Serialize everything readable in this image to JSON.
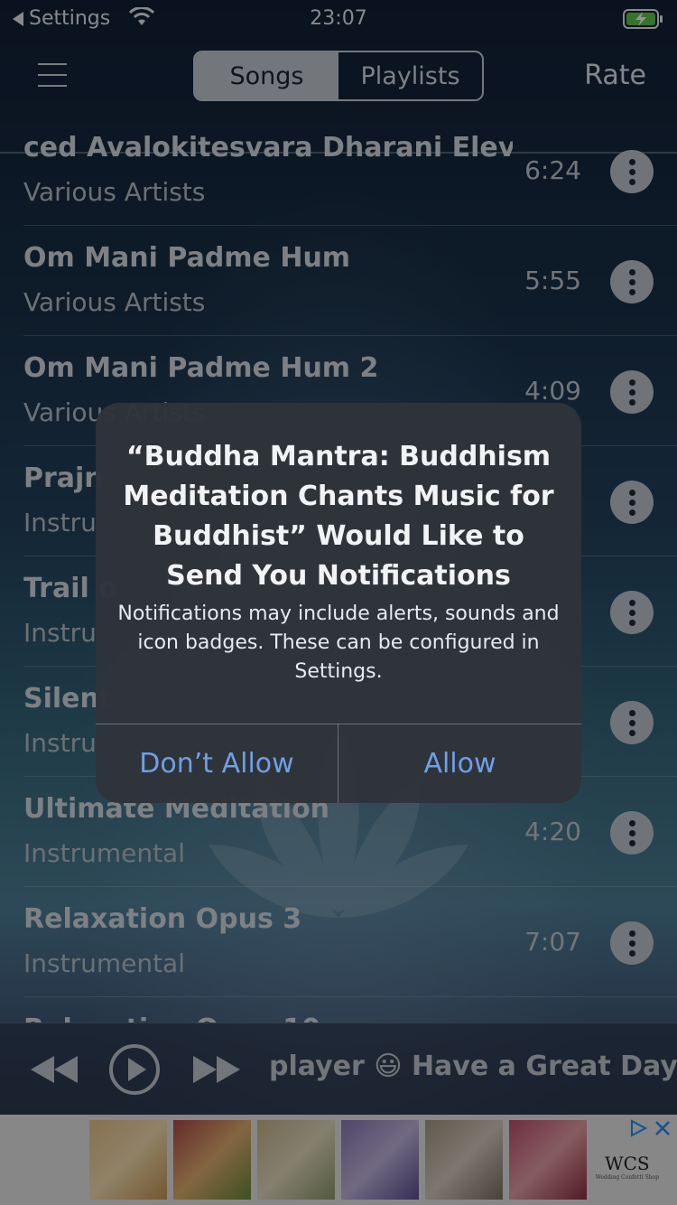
{
  "status_bar": {
    "back_label": "Settings",
    "time": "23:07"
  },
  "nav": {
    "tabs": [
      "Songs",
      "Playlists"
    ],
    "active_tab": "Songs",
    "rate_label": "Rate"
  },
  "songs": [
    {
      "title": "ced Avalokitesvara Dharani        Elev",
      "artist": "Various Artists",
      "duration": "6:24"
    },
    {
      "title": "Om Mani Padme Hum",
      "artist": "Various Artists",
      "duration": "5:55"
    },
    {
      "title": "Om Mani Padme Hum 2",
      "artist": "Various Artists",
      "duration": "4:09"
    },
    {
      "title": "Prajn",
      "artist": "Instru",
      "duration": ""
    },
    {
      "title": "Trail o",
      "artist": "Instru",
      "duration": ""
    },
    {
      "title": "Silent",
      "artist": "Instru",
      "duration": ""
    },
    {
      "title": "Ultimate Meditation",
      "artist": "Instrumental",
      "duration": "4:20"
    },
    {
      "title": "Relaxation Opus 3",
      "artist": "Instrumental",
      "duration": "7:07"
    },
    {
      "title": "Relaxation Opus 10",
      "artist": "",
      "duration": ""
    }
  ],
  "player": {
    "marquee": "player 😃 Have a Great Day ✨"
  },
  "alert": {
    "title": "“Buddha Mantra: Buddhism Meditation Chants Music for Buddhist” Would Like to Send You Notifications",
    "message": "Notifications may include alerts, sounds and icon badges. These can be configured in Settings.",
    "deny_label": "Don’t Allow",
    "allow_label": "Allow"
  },
  "ad": {
    "logo": "WCS",
    "tagline": "Wedding Confetti Shop"
  },
  "colors": {
    "alert_button": "#6f9fe6",
    "segment_active": "#c6ccd3"
  }
}
